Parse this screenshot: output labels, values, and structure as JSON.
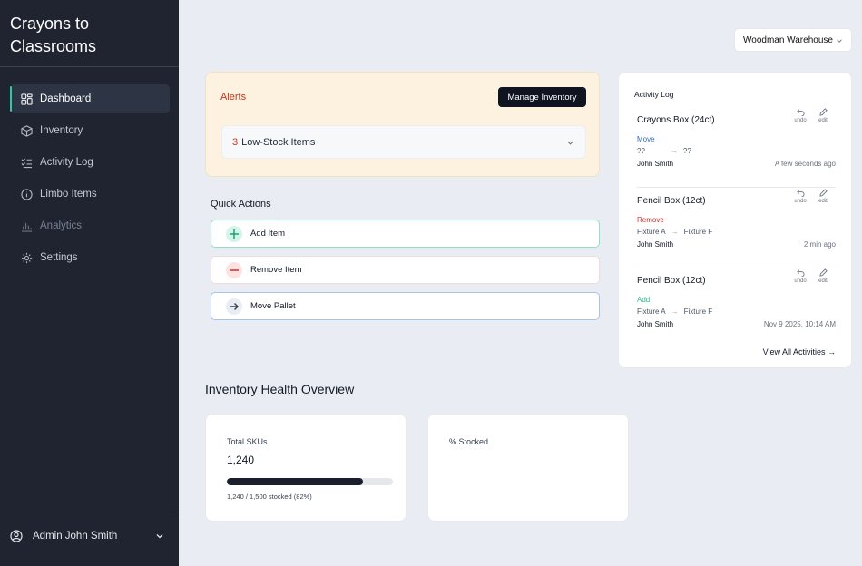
{
  "app": {
    "brand": "Crayons to Classrooms"
  },
  "sidebar": {
    "items": [
      {
        "label": "Dashboard",
        "icon": "dashboard-grid-icon",
        "active": true
      },
      {
        "label": "Inventory",
        "icon": "box-icon"
      },
      {
        "label": "Activity Log",
        "icon": "checklist-icon"
      },
      {
        "label": "Limbo Items",
        "icon": "info-circle-icon"
      },
      {
        "label": "Analytics",
        "icon": "bar-chart-icon",
        "muted": true
      },
      {
        "label": "Settings",
        "icon": "gear-icon"
      }
    ],
    "user": {
      "label": "Admin John Smith",
      "icon": "user-circle-icon"
    }
  },
  "header": {
    "warehouse": "Woodman Warehouse"
  },
  "alerts": {
    "title": "Alerts",
    "manage_label": "Manage Inventory",
    "low_stock_count": "3",
    "low_stock_text": "Low-Stock Items"
  },
  "quick_actions": {
    "title": "Quick Actions",
    "add": "Add Item",
    "remove": "Remove Item",
    "move": "Move Pallet"
  },
  "activity": {
    "title": "Activity Log",
    "undo_label": "undo",
    "edit_label": "edit",
    "entries": [
      {
        "item": "Crayons Box (24ct)",
        "type": "Move",
        "from": "??",
        "to": "??",
        "user": "John Smith",
        "time": "A few seconds ago"
      },
      {
        "item": "Pencil Box (12ct)",
        "type": "Remove",
        "from": "Fixture A",
        "to": "Fixture F",
        "user": "John Smith",
        "time": "2 min ago"
      },
      {
        "item": "Pencil Box (12ct)",
        "type": "Add",
        "from": "Fixture A",
        "to": "Fixture F",
        "user": "John Smith",
        "time": "Nov 9 2025, 10:14 AM"
      }
    ],
    "view_all": "View All Activities →"
  },
  "overview": {
    "title": "Inventory Health Overview",
    "skus": {
      "label": "Total SKUs",
      "value": "1,240",
      "stocked_fraction": 0.82,
      "sub": "1,240 / 1,500 stocked (82%)"
    },
    "stocked": {
      "label": "% Stocked"
    }
  },
  "colors": {
    "sidebar_bg": "#1f2430",
    "accent": "#34c6a6",
    "alert_red": "#c0391b",
    "alert_bg": "#fdf1e0"
  }
}
